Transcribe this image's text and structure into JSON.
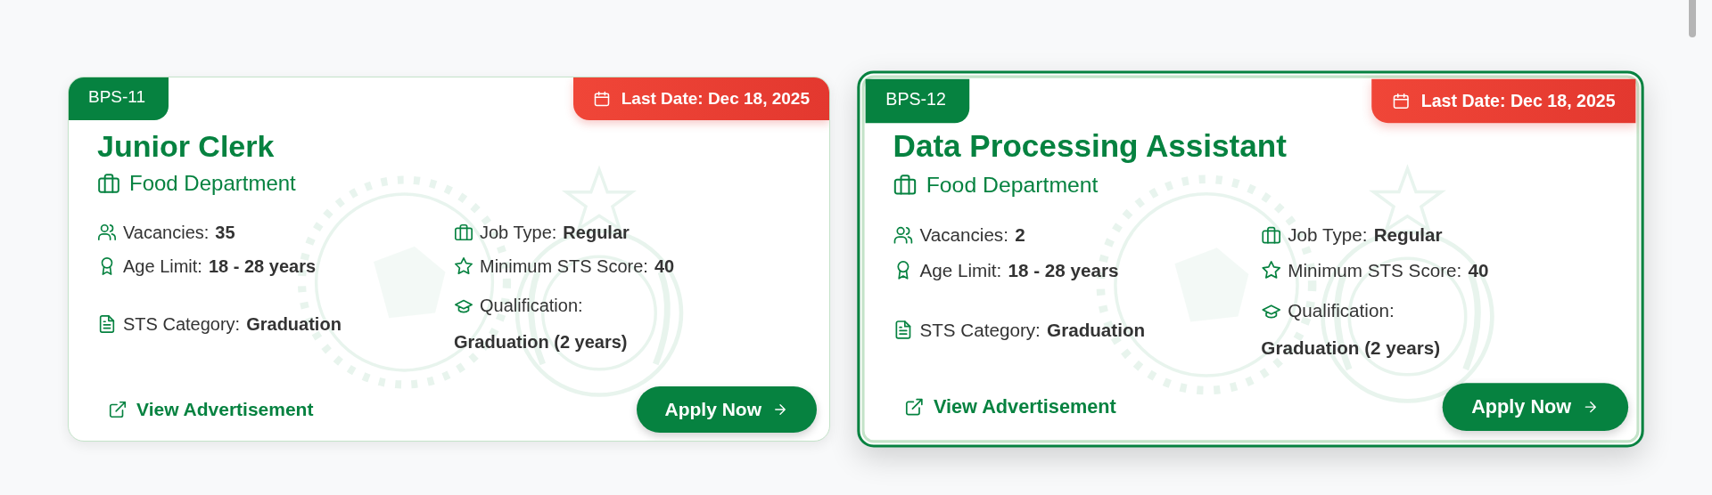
{
  "cards": [
    {
      "selected": false,
      "grade": "BPS-11",
      "last_date": "Last Date: Dec 18, 2025",
      "title": "Junior Clerk",
      "department": "Food Department",
      "details": [
        {
          "kind": "vacancies",
          "label": "Vacancies:",
          "value": "35"
        },
        {
          "kind": "age",
          "label": "Age Limit:",
          "value": "18 - 28 years"
        },
        {
          "kind": "category",
          "label": "STS Category:",
          "value": "Graduation"
        },
        {
          "kind": "job_type",
          "label": "Job Type:",
          "value": "Regular"
        },
        {
          "kind": "score",
          "label": "Minimum STS Score:",
          "value": "40"
        },
        {
          "kind": "qualification",
          "label": "Qualification:",
          "value": "Graduation (2 years)"
        }
      ],
      "link": "View Advertisement",
      "button": "Apply Now"
    },
    {
      "selected": true,
      "grade": "BPS-12",
      "last_date": "Last Date: Dec 18, 2025",
      "title": "Data Processing Assistant",
      "department": "Food Department",
      "details": [
        {
          "kind": "vacancies",
          "label": "Vacancies:",
          "value": "2"
        },
        {
          "kind": "age",
          "label": "Age Limit:",
          "value": "18 - 28 years"
        },
        {
          "kind": "category",
          "label": "STS Category:",
          "value": "Graduation"
        },
        {
          "kind": "job_type",
          "label": "Job Type:",
          "value": "Regular"
        },
        {
          "kind": "score",
          "label": "Minimum STS Score:",
          "value": "40"
        },
        {
          "kind": "qualification",
          "label": "Qualification:",
          "value": "Graduation (2 years)"
        }
      ],
      "link": "View Advertisement",
      "button": "Apply Now"
    }
  ]
}
